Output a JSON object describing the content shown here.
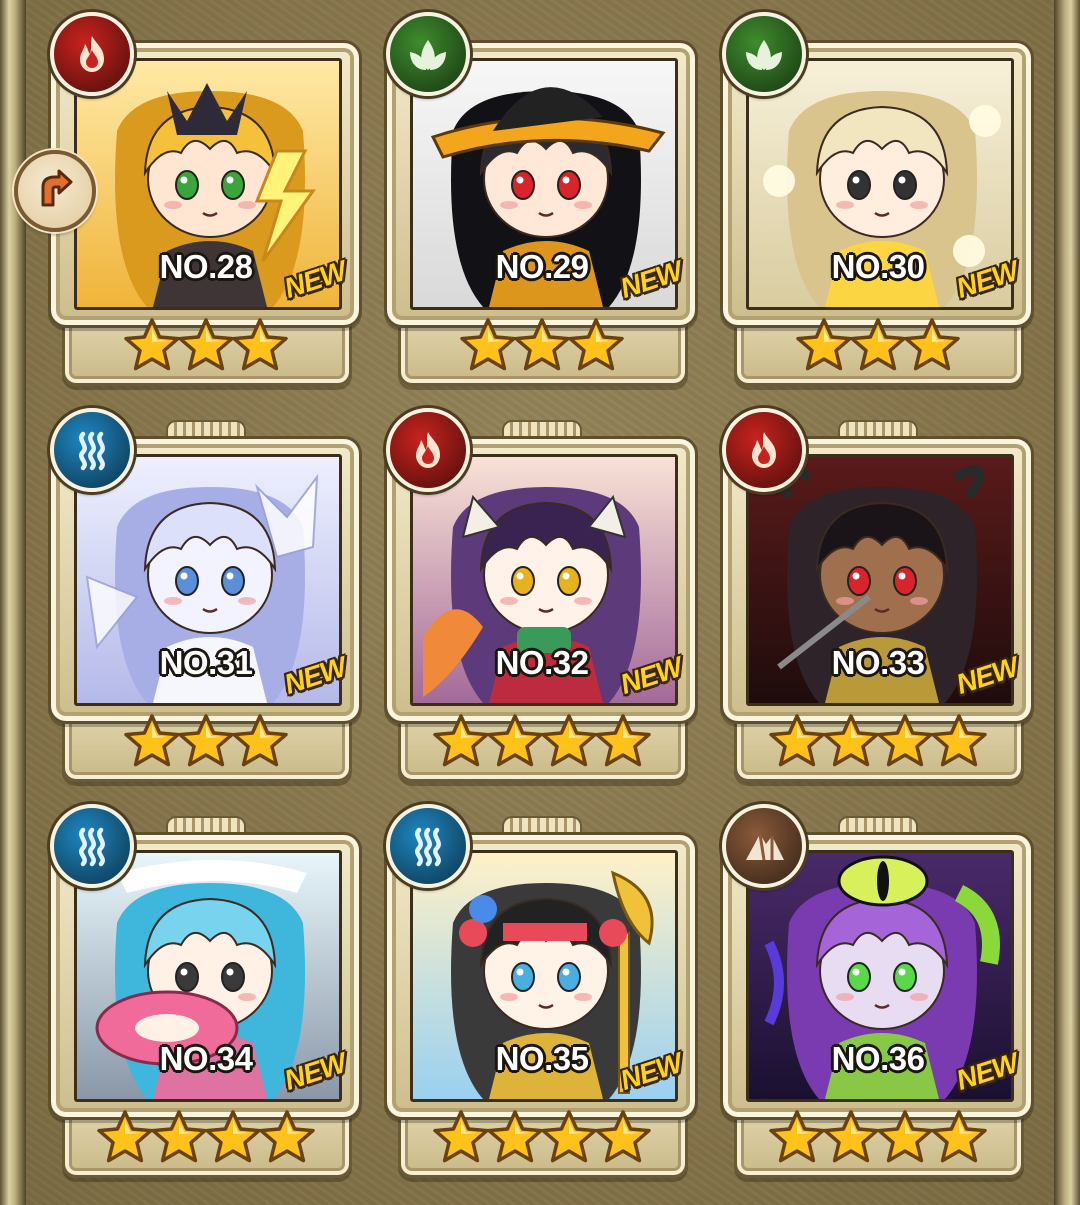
{
  "colors": {
    "fire": "#c8231e",
    "wood": "#3f8c2e",
    "water": "#1f87c2",
    "earth": "#8a5a3a",
    "new": "#ffd21f",
    "star": "#ffc21a"
  },
  "rarity_icon": "rarity-up-icon",
  "cards": [
    {
      "number": "NO.28",
      "element": "fire",
      "element_icon": "flame-icon",
      "new_label": "NEW",
      "stars": 3
    },
    {
      "number": "NO.29",
      "element": "wood",
      "element_icon": "leaf-icon",
      "new_label": "NEW",
      "stars": 3
    },
    {
      "number": "NO.30",
      "element": "wood",
      "element_icon": "leaf-icon",
      "new_label": "NEW",
      "stars": 3
    },
    {
      "number": "NO.31",
      "element": "water",
      "element_icon": "waves-icon",
      "new_label": "NEW",
      "stars": 3
    },
    {
      "number": "NO.32",
      "element": "fire",
      "element_icon": "flame-icon",
      "new_label": "NEW",
      "stars": 4
    },
    {
      "number": "NO.33",
      "element": "fire",
      "element_icon": "flame-icon",
      "new_label": "NEW",
      "stars": 4
    },
    {
      "number": "NO.34",
      "element": "water",
      "element_icon": "waves-icon",
      "new_label": "NEW",
      "stars": 4
    },
    {
      "number": "NO.35",
      "element": "water",
      "element_icon": "waves-icon",
      "new_label": "NEW",
      "stars": 4
    },
    {
      "number": "NO.36",
      "element": "earth",
      "element_icon": "mountain-icon",
      "new_label": "NEW",
      "stars": 4
    }
  ]
}
